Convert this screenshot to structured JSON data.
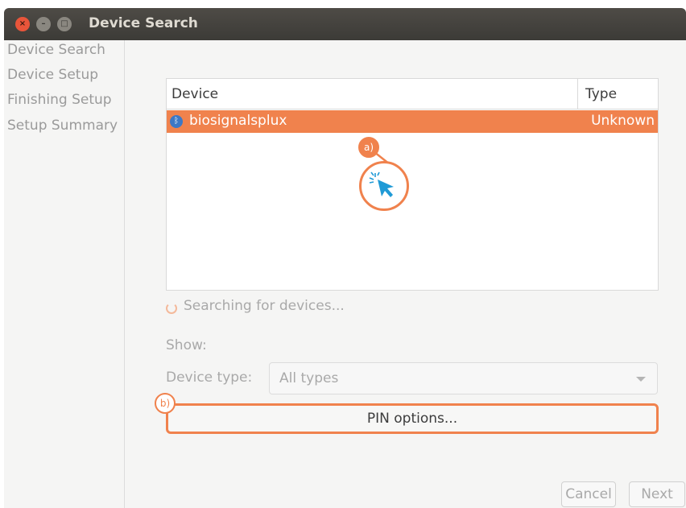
{
  "window": {
    "title": "Device Search",
    "controls": {
      "close": "×",
      "minimize": "–",
      "maximize": "□"
    }
  },
  "sidebar": {
    "steps": [
      "Device Search",
      "Device Setup",
      "Finishing Setup",
      "Setup Summary"
    ]
  },
  "device_list": {
    "columns": {
      "device": "Device",
      "type": "Type"
    },
    "rows": [
      {
        "name": "biosignalsplux",
        "type": "Unknown",
        "icon": "bluetooth-icon",
        "selected": true
      }
    ]
  },
  "callouts": {
    "a": "a)",
    "b": "b)"
  },
  "status": {
    "searching": "Searching for devices..."
  },
  "filters": {
    "show_label": "Show:",
    "device_type_label": "Device type:",
    "device_type_value": "All types"
  },
  "buttons": {
    "pin_options": "PIN options...",
    "cancel": "Cancel",
    "next": "Next"
  },
  "colors": {
    "accent": "#f0824d",
    "titlebar": "#3c3b37",
    "bluetooth": "#3d78c6",
    "cursor": "#1f9ad6"
  }
}
